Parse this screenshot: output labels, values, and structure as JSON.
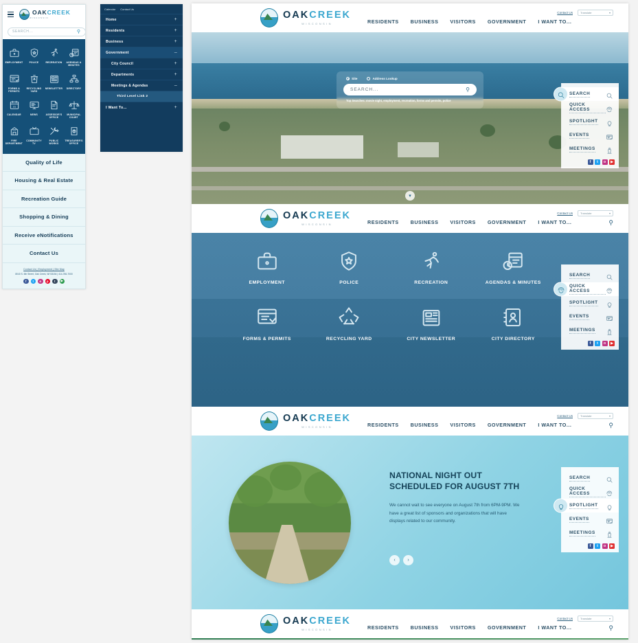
{
  "brand": {
    "name_dark": "OAK",
    "name_light": "CREEK",
    "tagline": "WISCONSIN"
  },
  "mobile_panel": {
    "search_placeholder": "SEARCH...",
    "tiles": [
      {
        "label": "EMPLOYMENT",
        "icon": "briefcase-icon"
      },
      {
        "label": "POLICE",
        "icon": "police-badge-icon"
      },
      {
        "label": "RECREATION",
        "icon": "runner-icon"
      },
      {
        "label": "AGENDAS & MINUTES",
        "icon": "calendar-clock-icon"
      },
      {
        "label": "FORMS & PERMITS",
        "icon": "form-window-icon"
      },
      {
        "label": "RECYCLING YARD",
        "icon": "recycle-bin-icon"
      },
      {
        "label": "NEWSLETTER",
        "icon": "newspaper-icon"
      },
      {
        "label": "DIRECTORY",
        "icon": "org-chart-icon"
      },
      {
        "label": "CALENDAR",
        "icon": "calendar-icon"
      },
      {
        "label": "NEWS",
        "icon": "monitor-news-icon"
      },
      {
        "label": "ASSESSOR'S OFFICE",
        "icon": "document-hand-icon"
      },
      {
        "label": "MUNICIPAL COURT",
        "icon": "scales-icon"
      },
      {
        "label": "FIRE DEPARTMENT",
        "icon": "fire-station-icon"
      },
      {
        "label": "COMMUNITY TV",
        "icon": "television-icon"
      },
      {
        "label": "PUBLIC WORKS",
        "icon": "tools-icon"
      },
      {
        "label": "TREASURER'S OFFICE",
        "icon": "money-icon"
      }
    ],
    "links": [
      "Quality of Life",
      "Housing & Real Estate",
      "Recreation Guide",
      "Shopping & Dining",
      "Receive eNotifications",
      "Contact Us"
    ],
    "footer_links": "Contact Us  |  Employment  |  Site Map",
    "address": "8040 S. 6th Street, Oak Creek, WI 53154  |  414-766-7000",
    "socials": [
      {
        "name": "facebook-icon",
        "glyph": "f",
        "color": "#3b5998"
      },
      {
        "name": "twitter-icon",
        "glyph": "t",
        "color": "#1da1f2"
      },
      {
        "name": "instagram-icon",
        "glyph": "o",
        "color": "#c13584"
      },
      {
        "name": "pinterest-icon",
        "glyph": "p",
        "color": "#e60023"
      },
      {
        "name": "tumblr-icon",
        "glyph": "t",
        "color": "#35465c"
      },
      {
        "name": "youtube-icon",
        "glyph": "▶",
        "color": "#2e9b4f"
      }
    ]
  },
  "menu_panel": {
    "top_links": [
      "Calendar",
      "Contact Us"
    ],
    "items": [
      {
        "label": "Home",
        "toggle": "+",
        "level": 1,
        "active": false
      },
      {
        "label": "Residents",
        "toggle": "+",
        "level": 1,
        "active": false
      },
      {
        "label": "Business",
        "toggle": "+",
        "level": 1,
        "active": false
      },
      {
        "label": "Government",
        "toggle": "–",
        "level": 1,
        "active": true
      },
      {
        "label": "City Council",
        "toggle": "+",
        "level": 2,
        "active": false
      },
      {
        "label": "Departments",
        "toggle": "+",
        "level": 2,
        "active": false
      },
      {
        "label": "Meetings & Agendas",
        "toggle": "–",
        "level": 2,
        "active": false
      },
      {
        "label": "Third Level Link 2",
        "toggle": "",
        "level": 3,
        "active": false
      },
      {
        "label": "I Want To...",
        "toggle": "+",
        "level": 1,
        "active": false
      }
    ]
  },
  "header": {
    "nav": [
      "RESIDENTS",
      "BUSINESS",
      "VISITORS",
      "GOVERNMENT",
      "I WANT TO..."
    ],
    "contact_label": "Contact Us",
    "translate_label": "Translate"
  },
  "hero": {
    "radio_site": "Site",
    "radio_address": "Address Lookup",
    "search_placeholder": "SEARCH...",
    "top_searches": "Top Searches: movie night, employment, recreation, forms and permits, police"
  },
  "side_panel": {
    "items": [
      {
        "label": "SEARCH",
        "icon": "magnifier-icon"
      },
      {
        "label": "QUICK ACCESS",
        "icon": "fingerprint-icon"
      },
      {
        "label": "SPOTLIGHT",
        "icon": "lightbulb-icon"
      },
      {
        "label": "EVENTS",
        "icon": "event-card-icon"
      },
      {
        "label": "MEETINGS",
        "icon": "podium-icon"
      }
    ],
    "socials": [
      {
        "name": "facebook-icon",
        "glyph": "f",
        "color": "#3b5998"
      },
      {
        "name": "twitter-icon",
        "glyph": "t",
        "color": "#1da1f2"
      },
      {
        "name": "instagram-icon",
        "glyph": "o",
        "color": "#c13584"
      },
      {
        "name": "youtube-icon",
        "glyph": "▶",
        "color": "#e02f2f"
      }
    ],
    "active_hero": "SEARCH",
    "active_quick": "QUICK ACCESS",
    "active_spotlight": "SPOTLIGHT"
  },
  "quick_access": {
    "tiles": [
      {
        "label": "EMPLOYMENT",
        "icon": "briefcase-icon"
      },
      {
        "label": "POLICE",
        "icon": "police-badge-icon"
      },
      {
        "label": "RECREATION",
        "icon": "runner-icon"
      },
      {
        "label": "AGENDAS & MINUTES",
        "icon": "calendar-clock-icon"
      },
      {
        "label": "FORMS & PERMITS",
        "icon": "form-window-icon"
      },
      {
        "label": "RECYCLING YARD",
        "icon": "recycle-icon"
      },
      {
        "label": "CITY NEWSLETTER",
        "icon": "newspaper-icon"
      },
      {
        "label": "CITY DIRECTORY",
        "icon": "address-book-icon"
      }
    ]
  },
  "spotlight": {
    "title_line1": "NATIONAL NIGHT OUT",
    "title_line2": "SCHEDULED FOR AUGUST 7TH",
    "body": "We cannot wait to see everyone on August 7th from 6PM-9PM. We have a great list of sponsors and organizations that will have displays related to our community.",
    "prev": "‹",
    "next": "›"
  },
  "colors": {
    "deep_navy": "#123c5e",
    "panel_blue": "#155078",
    "accent_cyan": "#3ba7cf",
    "light_bg": "#eaf6f8",
    "spotlight_bg": "#8fd3e4"
  }
}
